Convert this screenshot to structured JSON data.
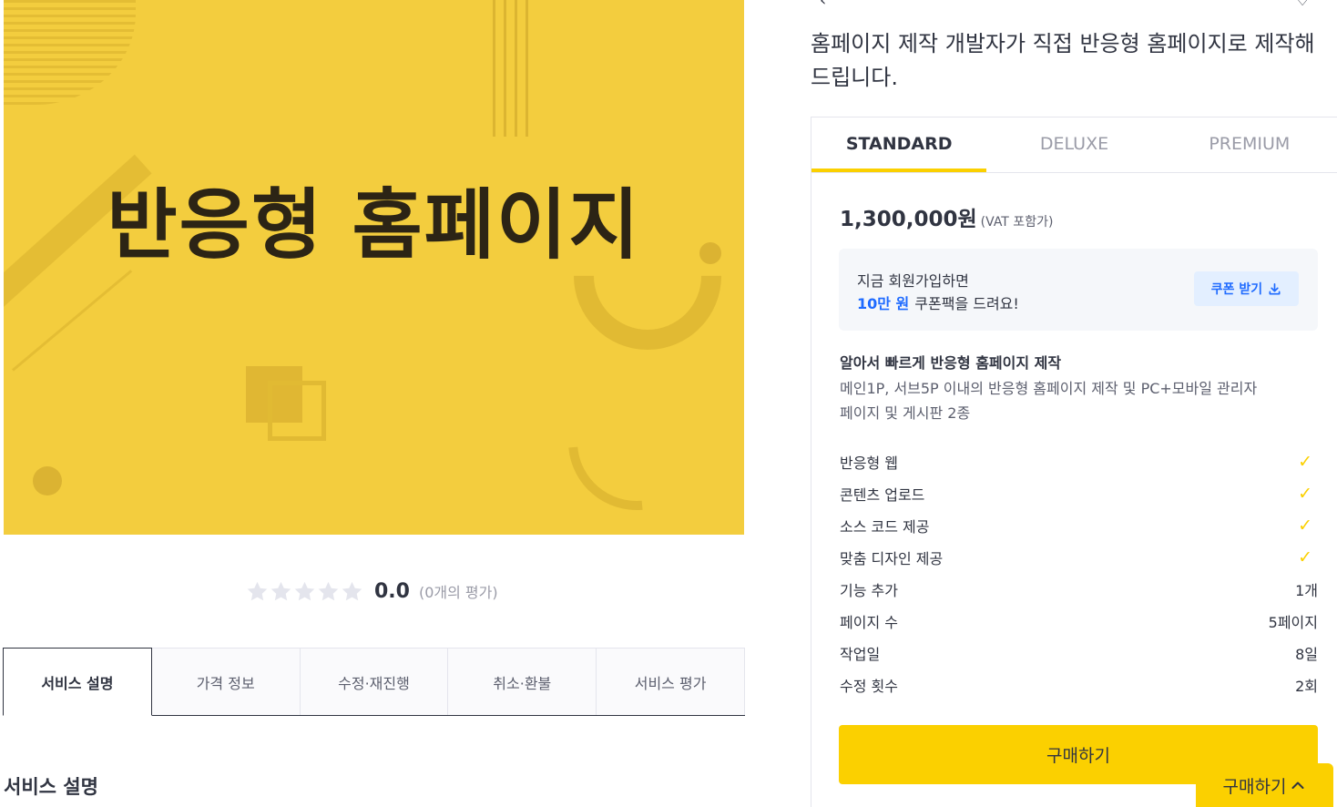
{
  "hero": {
    "title": "반응형 홈페이지"
  },
  "rating": {
    "stars_filled": 0,
    "stars_total": 5,
    "score": "0.0",
    "count_label": "(0개의 평가)"
  },
  "tabs": [
    {
      "label": "서비스 설명",
      "active": true
    },
    {
      "label": "가격 정보",
      "active": false
    },
    {
      "label": "수정·재진행",
      "active": false
    },
    {
      "label": "취소·환불",
      "active": false
    },
    {
      "label": "서비스 평가",
      "active": false
    }
  ],
  "section_title": "서비스 설명",
  "product": {
    "title": "홈페이지 제작 개발자가 직접 반응형 홈페이지로 제작해 드립니다."
  },
  "packages": {
    "tabs": [
      {
        "label": "STANDARD",
        "active": true
      },
      {
        "label": "DELUXE",
        "active": false
      },
      {
        "label": "PREMIUM",
        "active": false
      }
    ],
    "price": "1,300,000원",
    "vat": "(VAT 포함가)",
    "coupon": {
      "line1": "지금 회원가입하면",
      "amount": "10만 원",
      "line2_rest": "쿠폰팩을 드려요!",
      "button_label": "쿠폰 받기"
    },
    "title": "알아서 빠르게 반응형 홈페이지 제작",
    "description": "메인1P, 서브5P 이내의 반응형 홈페이지 제작 및 PC+모바일 관리자페이지 및 게시판 2종",
    "features": [
      {
        "label": "반응형 웹",
        "value": "✓"
      },
      {
        "label": "콘텐츠 업로드",
        "value": "✓"
      },
      {
        "label": "소스 코드 제공",
        "value": "✓"
      },
      {
        "label": "맞춤 디자인 제공",
        "value": "✓"
      },
      {
        "label": "기능 추가",
        "value": "1개"
      },
      {
        "label": "페이지 수",
        "value": "5페이지"
      },
      {
        "label": "작업일",
        "value": "8일"
      },
      {
        "label": "수정 횟수",
        "value": "2회"
      }
    ],
    "buy_label": "구매하기"
  },
  "floating_buy": {
    "label": "구매하기"
  },
  "colors": {
    "accent": "#fbd000",
    "hero_bg": "#f3cd3e",
    "link_blue": "#1f6bff",
    "text": "#303441"
  }
}
